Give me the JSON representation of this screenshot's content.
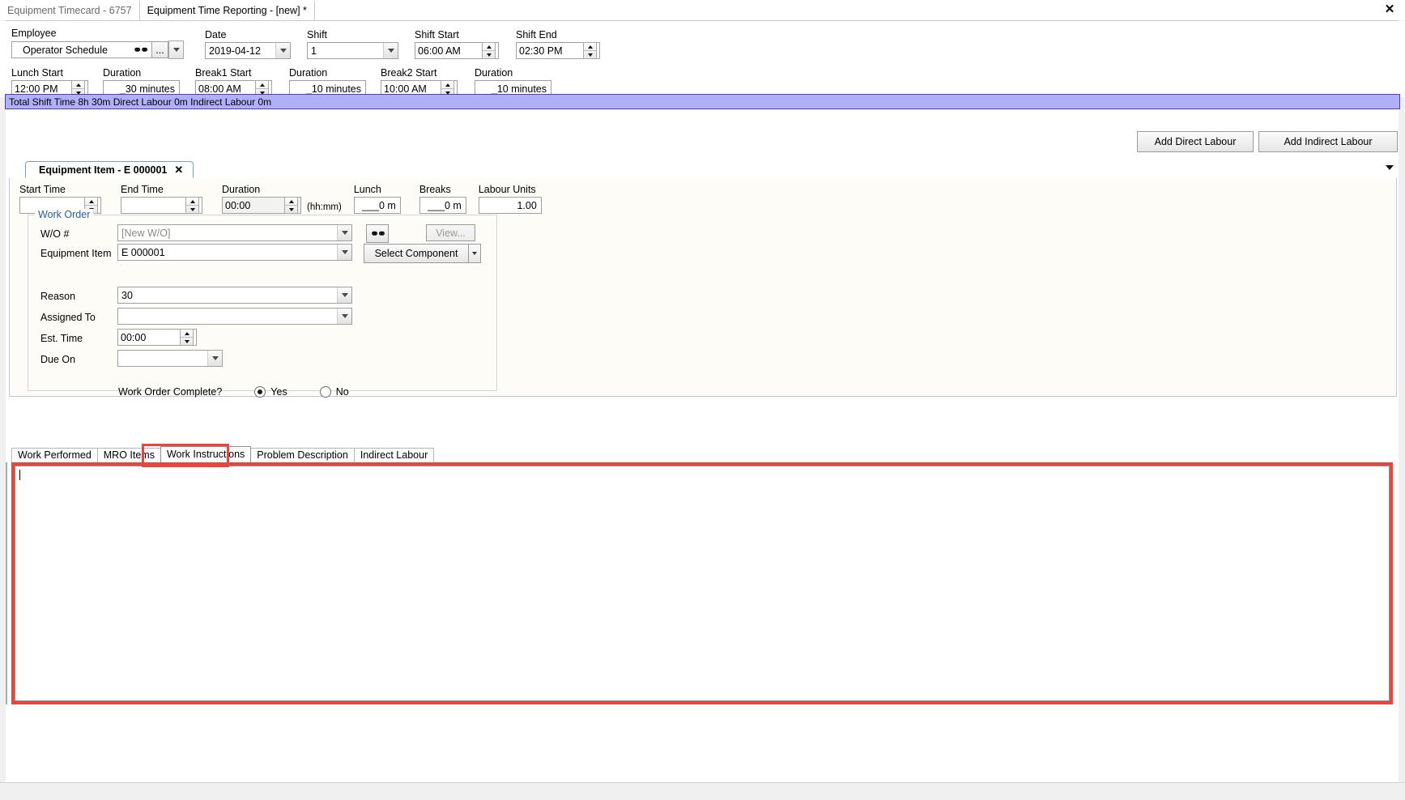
{
  "window": {
    "close_label": "✕",
    "tabs": [
      {
        "label": "Equipment Timecard - 6757",
        "active": false
      },
      {
        "label": "Equipment Time Reporting - [new] *",
        "active": true
      }
    ]
  },
  "header_form": {
    "row1": {
      "employee": {
        "label": "Employee",
        "value": "Operator Schedule",
        "ellipsis_label": "..."
      },
      "date": {
        "label": "Date",
        "value": "2019-04-12"
      },
      "shift": {
        "label": "Shift",
        "value": "1"
      },
      "shift_start": {
        "label": "Shift Start",
        "value": "06:00 AM"
      },
      "shift_end": {
        "label": "Shift End",
        "value": "02:30 PM"
      }
    },
    "row2": {
      "lunch_start": {
        "label": "Lunch Start",
        "value": "12:00 PM"
      },
      "lunch_duration": {
        "label": "Duration",
        "value": "_30 minutes"
      },
      "break1_start": {
        "label": "Break1 Start",
        "value": "08:00 AM"
      },
      "break1_duration": {
        "label": "Duration",
        "value": "_10 minutes"
      },
      "break2_start": {
        "label": "Break2 Start",
        "value": "10:00 AM"
      },
      "break2_duration": {
        "label": "Duration",
        "value": "_10 minutes"
      }
    }
  },
  "status_bar": {
    "text": "Total Shift Time 8h 30m  Direct Labour 0m  Indirect Labour 0m",
    "background": "#b0b0fa",
    "border": "#4b3fbe"
  },
  "action_buttons": {
    "add_direct_labour": "Add Direct Labour",
    "add_indirect_labour": "Add Indirect Labour"
  },
  "equipment_tab": {
    "label": "Equipment Item - E 000001",
    "close_glyph": "✕"
  },
  "time_row": {
    "start_time": {
      "label": "Start Time",
      "value": ""
    },
    "end_time": {
      "label": "End Time",
      "value": ""
    },
    "duration": {
      "label": "Duration",
      "value": "00:00",
      "suffix": "(hh:mm)"
    },
    "lunch": {
      "label": "Lunch",
      "value": "___0 m"
    },
    "breaks": {
      "label": "Breaks",
      "value": "___0 m"
    },
    "labour_units": {
      "label": "Labour Units",
      "value": "1.00"
    }
  },
  "work_order": {
    "legend": "Work Order",
    "wo_number": {
      "label": "W/O #",
      "value": "[New W/O]"
    },
    "view_button": "View...",
    "equipment_item": {
      "label": "Equipment Item",
      "value": "E 000001"
    },
    "select_component_button": "Select Component",
    "reason": {
      "label": "Reason",
      "value": "30"
    },
    "assigned_to": {
      "label": "Assigned To",
      "value": ""
    },
    "est_time": {
      "label": "Est. Time",
      "value": "00:00"
    },
    "due_on": {
      "label": "Due On",
      "value": ""
    },
    "complete": {
      "label": "Work Order Complete?",
      "yes_label": "Yes",
      "no_label": "No",
      "selected": "Yes"
    }
  },
  "bottom_tabs": {
    "highlight_color": "#e8453c",
    "items": [
      {
        "label": "Work Performed",
        "active": false
      },
      {
        "label": "MRO Items",
        "active": false
      },
      {
        "label": "Work Instructions",
        "active": true
      },
      {
        "label": "Problem Description",
        "active": false
      },
      {
        "label": "Indirect Labour",
        "active": false
      }
    ]
  },
  "text_editor": {
    "value": ""
  }
}
